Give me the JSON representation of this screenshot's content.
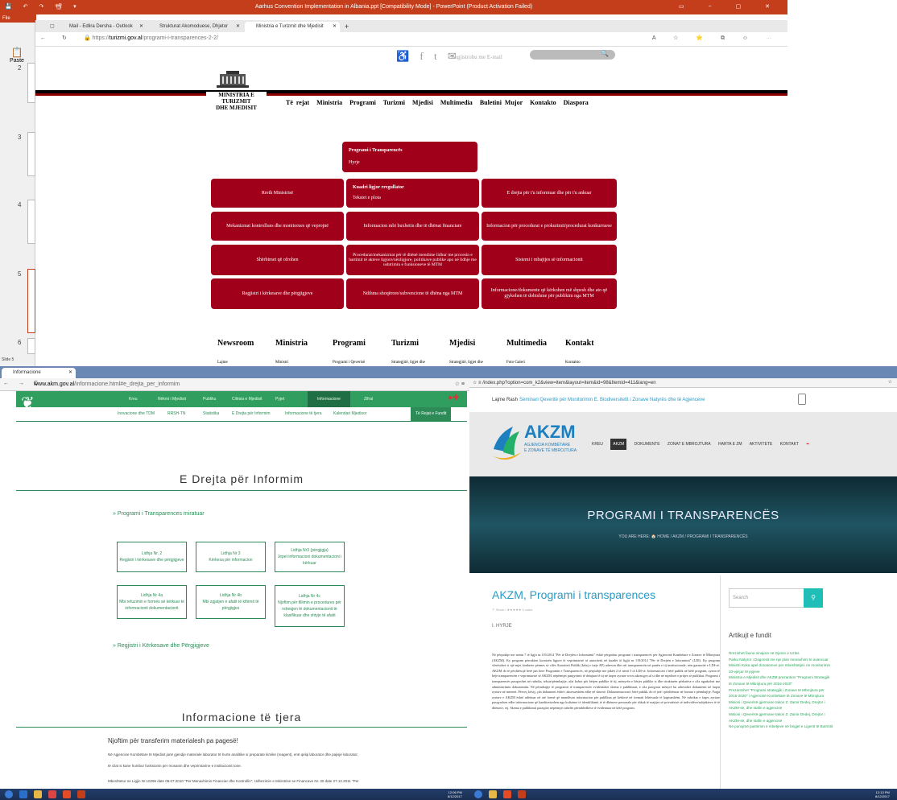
{
  "ppt": {
    "title": "Aarhus Convention Implementation in Albania.ppt [Compatibility Mode] - PowerPoint (Product Activation Failed)",
    "file_label": "File",
    "paste_label": "Paste",
    "slide_numbers": [
      "2",
      "3",
      "4",
      "5",
      "6"
    ],
    "slide_label": "Slide 5"
  },
  "browser1": {
    "tabs": [
      {
        "label": "Mail - Edlira Dersha - Outlook"
      },
      {
        "label": "Strukturat Akomoduese, Dhjetor"
      },
      {
        "label": "Ministria e Turizmit dhe Mjedisit"
      }
    ],
    "url_prefix": "https://",
    "url_host": "turizmi.gov.al",
    "url_path": "/programi-i-transparences-2-2/",
    "site": {
      "social_icons": "♿ f t ✉",
      "register_text": "Regjistrohu me E-mail",
      "search_icon": "🔍",
      "ministry_line1": "MINISTRIA E TURIZMIT",
      "ministry_line2": "DHE MJEDISIT",
      "menu": [
        "Të rejat",
        "Ministria",
        "Programi",
        "Turizmi",
        "Mjedisi",
        "Multimedia",
        "Buletini Mujor",
        "Kontakto",
        "Diaspora"
      ],
      "header_box": {
        "line1": "Programi i Transparencës",
        "line2": "Hyrje"
      },
      "boxes": [
        {
          "text": "Rreth Ministrisë"
        },
        {
          "text": "Kuadri ligjor rregullator",
          "sub": "Tekstet e plota"
        },
        {
          "text": "E drejta për t'u informuar dhe për t'u ankuar"
        },
        {
          "text": "Mekanizmat kontrollues dhe monitorues që veprojnë"
        },
        {
          "text": "Informacion mbi buxhetin dhe të dhënat financiare"
        },
        {
          "text": "Informacion për procedurat e prokurimit/procedurat konkurruese"
        },
        {
          "text": "Shërbimet që ofrohen"
        },
        {
          "text": "Procedurat/mekanizmat për të dhënë mendime lidhur me procesin e hartimit të akteve ligjore/nënligjore, politikave publike apo në lidhje me ushtrimin e funksioneve të MTM"
        },
        {
          "text": "Sistemi i mbajtjes së informacionit"
        },
        {
          "text": "Regjistri i kërkesave dhe përgjigjeve"
        },
        {
          "text": "Ndihma shoqërore/subvencione të dhëna nga MTM"
        },
        {
          "text": "Informacione/dokumente që kërkohen më shpesh dhe ato që gjykohen të dobishme për publikim nga MTM"
        }
      ],
      "footer_nav": [
        "Newsroom",
        "Ministria",
        "Programi",
        "Turizmi",
        "Mjedisi",
        "Multimedia",
        "Kontakt"
      ],
      "footer_sub": [
        "Lajme",
        "Ministri",
        "Programi i Qeverisë",
        "Strategjitë, ligjet dhe",
        "Strategjitë, ligjet dhe",
        "Foto Galeri",
        "Kontakto"
      ]
    }
  },
  "browser2": {
    "tab_label": "Informacione",
    "url_host": "www.akm.gov.al",
    "url_path": "/informacione.html#e_drejta_per_informim",
    "nav_top": [
      "Kreu",
      "Nëkmi i Mjedisit",
      "Publiku",
      "Cilësia e Mjedisit",
      "Pyjet",
      "Informacione",
      "Zifral"
    ],
    "nav_sub": [
      "Inovacione dhe TDM",
      "RRSH-TN",
      "Statistika",
      "E Drejta për Informim",
      "Informacione të tjera",
      "Kalendari Mjedisor"
    ],
    "nav_right": "Të Rejat e Fundit",
    "section_title": "E Drejta për Informim",
    "link1": "» Programi i Transparences miratuar",
    "boxes": [
      {
        "l1": "Lidhja Nr. 2",
        "l2": "Regjistri i kërkesave dhe përgjigjeve"
      },
      {
        "l1": "Lidhja Nr 3",
        "l2": "Kërkesa për informacion"
      },
      {
        "l1": "Lidhja Nr3 (përgjigja)",
        "l2": "Jepet informacioni dokumentacioni i kërkuar"
      },
      {
        "l1": "Lidhja Nr 4a",
        "l2": "Mbi refuzimin e formës së kërkuar të informacionit dokumentacionit"
      },
      {
        "l1": "Lidhja Nr 4b",
        "l2": "Mbi zgjatjen e afatit të kthimit të përgjigjes"
      },
      {
        "l1": "Lidhja Nr 4c",
        "l2": "Njoftim për fillimin e procedures për ndreqjen të dokumentacionit të klasifikuar dhe shtyje të afatit"
      }
    ],
    "link2": "» Regjistri i Kërkesave dhe Përgjigjeve",
    "section2_title": "Informacione të tjera",
    "notice_title": "Njoftim për transferim materialesh pa pagesë!",
    "notice_text1": "Në Agjencine Kombëtare të Mjedisit janë gjendje materiale laborator të hurte analitike si preparate kimike (reagent), enë qelqi laborator dhe pajisje laborator,",
    "notice_text2": "të cilat si kane humbur funksionin per mosanin dhe veprimtarine e institucionit tone.",
    "notice_text3": "Mbeshtetur ne Ligjin Nr.10296 date 08.07.2010 \"Per Menaxhimin Financiar dhe Kontrollin\", Udhezimin e Ministrise se Financave Nr. 30 date 27.12.2011 \"Per"
  },
  "browser3": {
    "url_path": "/index.php?option=com_k2&view=item&layout=item&id=98&Itemid=411&lang=en",
    "notif_text": "Lajme Rash",
    "notif_link": "Seminari Qeveritë për Monitorimin E. Biodiversitetit i Zonave Natyrës dhe të Agjenceve",
    "logo_big": "AKZM",
    "logo_sub1": "AGJENCIA KOMBËTARE",
    "logo_sub2": "E ZONAVE TË MBROJTURA",
    "menu": [
      "KREU",
      "AKZM",
      "DOKUMENTE",
      "ZONAT E MBROJTURA",
      "HARTA E ZM",
      "AKTIVITETE",
      "KONTAKT"
    ],
    "banner_title": "PROGRAMI I TRANSPARENCËS",
    "crumb": "YOU ARE HERE:  🏠 HOME  /  AKZM  /  PROGRAMI I TRANSPARENCËS",
    "heading": "AKZM, Programi i transparences",
    "meta": "↱ Share  /  ★★★★★ 0 votes",
    "hyrje": "I. HYRJE",
    "body": "Në përputhje me nenin 7 të ligjit nr.119/2014 \"Për të Drejtën e Informimit\" është përgatitur programi i transparencës për Agjencinë Kombëtare e Zonave të Mbrojtura (AKZM). Ky program përcakton kornizën ligjore të veprimtarisë së autoritetit në kuadër të ligjit nr 119/2014 \"Për të Drejtën e Informimit\" (LDI). Ky program vlerësohet si një mjet konkrete përmes së cilës Autoriteti Publik (këtej e tutje AP) adreson dhe rrit transparencën në punën e tij institucionale, nën garancitë e LDI-së. AKZM do të përditësojë herë pas here Programin e Transparencës, në përputhje me pikën 2 të nenit 5 të LDI-së. Informacioni i bërë publik në këtë program, synon të bëjë transparencën e veprimtarisë së AKZM, nëpërmjet pasqyrimit të detajuar të tij në faqen zyrtare www.akzm.gov.al si dhe në mjediset e pritjes së publikut. Programi i transparencës pasqyrohet në rubrika, tekste/përmbajtje, afat kohor për bërjen publike të tij, mënyrën e bërjes publike si dhe strukturën përkatëse e cila ngarkohet me administrimin dokumentin. Në përmbajtje të programit të transparencës evidentohet skema e publikimit, e cila pasqyron mënyrë ku adresohet dokumenti në faqen zyrtare në internet. Përveç kësaj, çdo dokument është i aksesueshëm edhe në shtresë. Dokumentacioni i bërë publik, do të jetë i përditësuar në format e përmbajtje. Faqja zyrtare e AKZM është ndërtuar në atë formë që mundëson informacion për publikun që kërkesë në formati lehtësuale të kuptueshëm. Në rubrikat e faqes zyrtare pasqyrohen edhe informacione që karakterizohen nga kufizime të identifikimit të të dhënave personale për shkak të ruajtjes së privatësisë së individëve/subjekteve të të dhënave, etj. Skema e publikimit paraqitet nëpërmjet tabelës përmbledhëse të evidentuar në këtë program.",
    "search_placeholder": "Search",
    "articles_title": "Artikujt e fundit",
    "articles": [
      "Rreziohet fauna ninajore në Gjenin e Uzles",
      "Parku Natyror i Dagonsit me nje plan menaxhimi te avancuar",
      "Ministri Koka apel donatoreve per mbeshtetjen ne monitorimin 10-vjeçar të pyjeve",
      "Ministria e Mjedisit dhe AKZM prezantion \"Programi Strategjik të Zonave të Mbrojtura për 2016-2020\"",
      "Prezantohet \"Programi strategjik i Zonave të Mbrojtura për 2016-2020\" i Agjencisë Kombëtare të Zonave të Mbrojtura",
      "Misioni i Qeverisë gjermane takon Z. Zamir Dedej, Drejtor i AKZM-së, dhe stafin e agjencisë",
      "Misioni i Qeverisë gjermane takon Z. Zamir Dedej, Drejtor i AKZM-së, dhe stafin e agjencisë",
      "Ne punojmë pastrimin e mbetjeve në brigjet e Ligenit të Butrintit"
    ]
  },
  "taskbar_left": {
    "time": "12:06 PM",
    "date": "8/12/2017"
  },
  "taskbar_right": {
    "time": "12:13 PM",
    "date": "8/12/2017"
  },
  "colors": {
    "ppt_red": "#c43e1c",
    "ministry_red": "#a0001a",
    "akm_green": "#2c8b57",
    "akzm_blue": "#2a9bc6"
  }
}
